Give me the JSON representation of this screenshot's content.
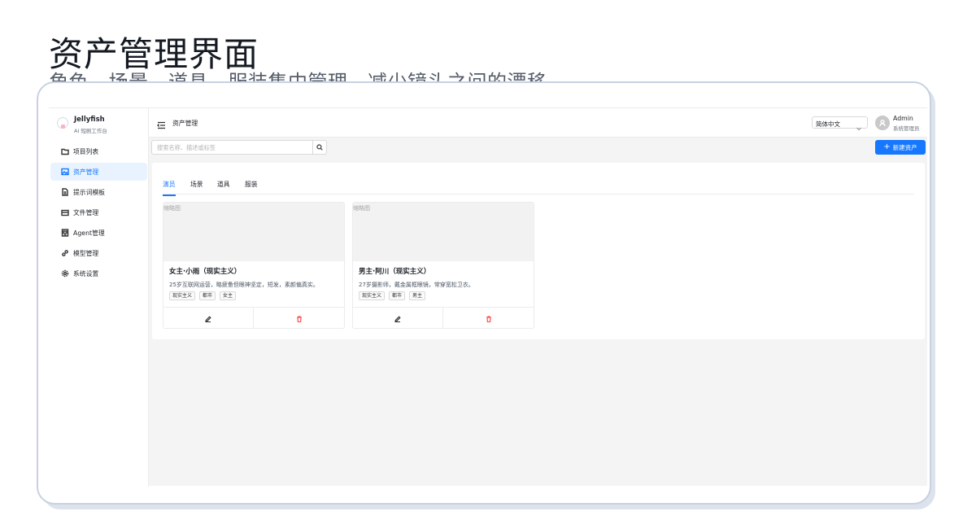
{
  "hero": {
    "title": "资产管理界面",
    "subtitle": "角色、场景、道具、服装集中管理，减少镜头之间的漂移"
  },
  "brand": {
    "name": "Jellyfish",
    "sub": "AI 短剧工作台"
  },
  "sidebar": {
    "items": [
      {
        "label": "项目列表",
        "icon": "folder-icon"
      },
      {
        "label": "资产管理",
        "icon": "image-icon",
        "active": true
      },
      {
        "label": "提示词模板",
        "icon": "document-icon"
      },
      {
        "label": "文件管理",
        "icon": "archive-icon"
      },
      {
        "label": "Agent管理",
        "icon": "robot-icon"
      },
      {
        "label": "模型管理",
        "icon": "link-icon"
      },
      {
        "label": "系统设置",
        "icon": "gear-icon"
      }
    ]
  },
  "topbar": {
    "breadcrumb": "资产管理",
    "language": "简体中文",
    "user_name": "Admin",
    "user_role": "系统管理员"
  },
  "toolbar": {
    "search_placeholder": "搜索名称、描述或标签",
    "new_button": "新建资产"
  },
  "tabs": [
    {
      "label": "演员",
      "active": true
    },
    {
      "label": "场景"
    },
    {
      "label": "道具"
    },
    {
      "label": "服装"
    }
  ],
  "cards": [
    {
      "thumb_label": "缩略图",
      "title": "女主·小雨（现实主义）",
      "description": "25岁互联网运营，略疲惫但眼神坚定，短发，素颜偏真实。",
      "tags": [
        "现实主义",
        "都市",
        "女主"
      ]
    },
    {
      "thumb_label": "缩略图",
      "title": "男主·阿川（现实主义）",
      "description": "27岁摄影师，戴金属框眼镜，常穿宽松卫衣。",
      "tags": [
        "现实主义",
        "都市",
        "男主"
      ]
    }
  ],
  "colors": {
    "accent": "#1677ff",
    "danger": "#ff4d4f",
    "active_bg": "#e8f3ff"
  }
}
